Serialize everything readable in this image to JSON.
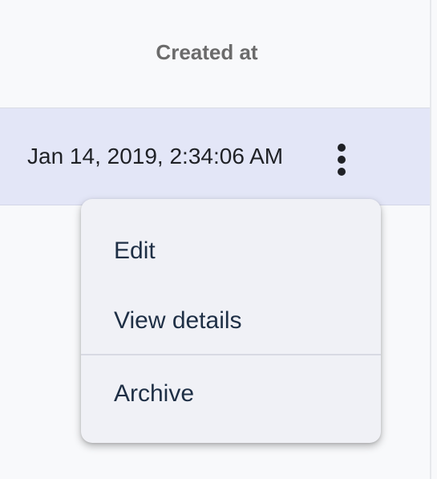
{
  "table": {
    "column_header": "Created at",
    "rows": [
      {
        "created_at": "Jan 14, 2019, 2:34:06 AM"
      }
    ]
  },
  "context_menu": {
    "items": [
      {
        "label": "Edit"
      },
      {
        "label": "View details"
      },
      {
        "label": "Archive"
      }
    ]
  },
  "icons": {
    "row_actions": "kebab-vertical-icon"
  }
}
